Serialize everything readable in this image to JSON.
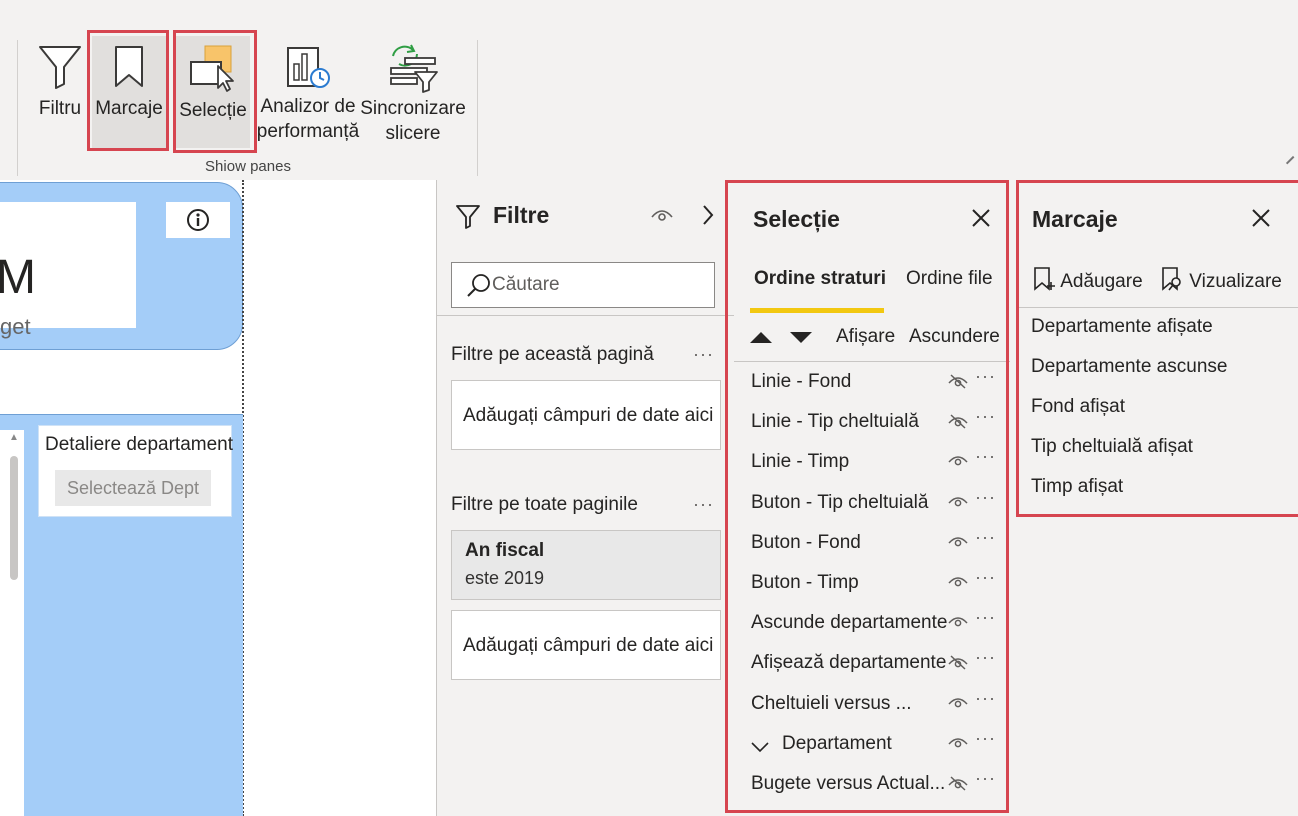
{
  "ribbon": {
    "buttons": [
      {
        "label": "Filtru",
        "icon": "filter-icon"
      },
      {
        "label": "Marcaje",
        "icon": "bookmark-icon"
      },
      {
        "label": "Selecție",
        "icon": "selection-icon"
      },
      {
        "label_line1": "Analizor de",
        "label_line2": "performanță",
        "icon": "performance-analyzer-icon"
      },
      {
        "label_line1": "Sincronizare",
        "label_line2": "slicere",
        "icon": "sync-slicers-icon"
      }
    ],
    "group_label": "Shiow panes"
  },
  "canvas": {
    "big_letter": "M",
    "subtitle_fragment": "get",
    "info_icon": "info-icon",
    "dept_slicer_title": "Detaliere departament",
    "dept_button_label": "Selectează Dept"
  },
  "filters_pane": {
    "title": "Filtre",
    "search_placeholder": "Căutare",
    "page_section_label": "Filtre pe această pagină",
    "page_drop_label": "Adăugați câmpuri de date aici",
    "all_pages_section_label": "Filtre pe toate paginile",
    "fiscal_filter_title": "An fiscal",
    "fiscal_filter_value": "este 2019",
    "all_pages_drop_label": "Adăugați câmpuri de date aici",
    "more": "···"
  },
  "selection_pane": {
    "title": "Selecție",
    "tabs": [
      {
        "label": "Ordine straturi",
        "active": true
      },
      {
        "label": "Ordine file",
        "active": false
      }
    ],
    "show_label": "Afișare",
    "hide_label": "Ascundere",
    "layers": [
      {
        "name": "Linie - Fond",
        "visible": false
      },
      {
        "name": "Linie - Tip cheltuială",
        "visible": false
      },
      {
        "name": "Linie - Timp",
        "visible": true
      },
      {
        "name": "Buton - Tip cheltuială",
        "visible": true
      },
      {
        "name": "Buton - Fond",
        "visible": true
      },
      {
        "name": "Buton - Timp",
        "visible": true
      },
      {
        "name": "Ascunde departamente",
        "visible": true
      },
      {
        "name": "Afișează departamente",
        "visible": false
      },
      {
        "name": "Cheltuieli versus ...",
        "visible": true
      },
      {
        "name": "Departament",
        "visible": true,
        "group": true
      },
      {
        "name": "Bugete versus Actual...",
        "visible": false
      }
    ],
    "more": "···"
  },
  "bookmarks_pane": {
    "title": "Marcaje",
    "add_label": "Adăugare",
    "view_label": "Vizualizare",
    "items": [
      "Departamente afișate",
      "Departamente ascunse",
      "Fond afișat",
      "Tip cheltuială afișat",
      "Timp afișat"
    ]
  },
  "colors": {
    "highlight_box": "#d64550",
    "active_tab_underline": "#f2c811",
    "canvas_blue": "#a4cdf8"
  }
}
